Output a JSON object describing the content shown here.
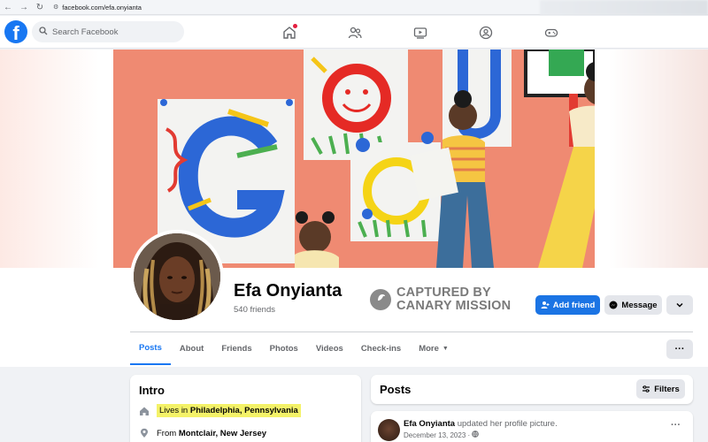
{
  "browser": {
    "url": "facebook.com/efa.onyianta"
  },
  "header": {
    "logo": "f",
    "search_placeholder": "Search Facebook",
    "nav": [
      "home-icon",
      "friends-icon",
      "watch-icon",
      "groups-icon",
      "gaming-icon"
    ]
  },
  "profile": {
    "name": "Efa Onyianta",
    "friends": "540 friends",
    "add_friend": "Add friend",
    "message": "Message",
    "more": "⌄"
  },
  "watermark": {
    "line1": "CAPTURED BY",
    "line2": "CANARY MISSION"
  },
  "tabs": [
    {
      "label": "Posts",
      "active": true
    },
    {
      "label": "About"
    },
    {
      "label": "Friends"
    },
    {
      "label": "Photos"
    },
    {
      "label": "Videos"
    },
    {
      "label": "Check-ins"
    },
    {
      "label": "More"
    }
  ],
  "tabs_more_button": "···",
  "intro": {
    "title": "Intro",
    "lives_prefix": "Lives in ",
    "lives_place": "Philadelphia, Pennsylvania",
    "from_prefix": "From ",
    "from_place": "Montclair, New Jersey"
  },
  "posts": {
    "title": "Posts",
    "filters": "Filters",
    "post": {
      "author": "Efa Onyianta",
      "action": " updated her profile picture.",
      "date": "December 13, 2023 · ",
      "menu": "···"
    }
  },
  "colors": {
    "brand": "#1877f2",
    "cover": "#f08a73",
    "highlight": "#f4f268"
  }
}
